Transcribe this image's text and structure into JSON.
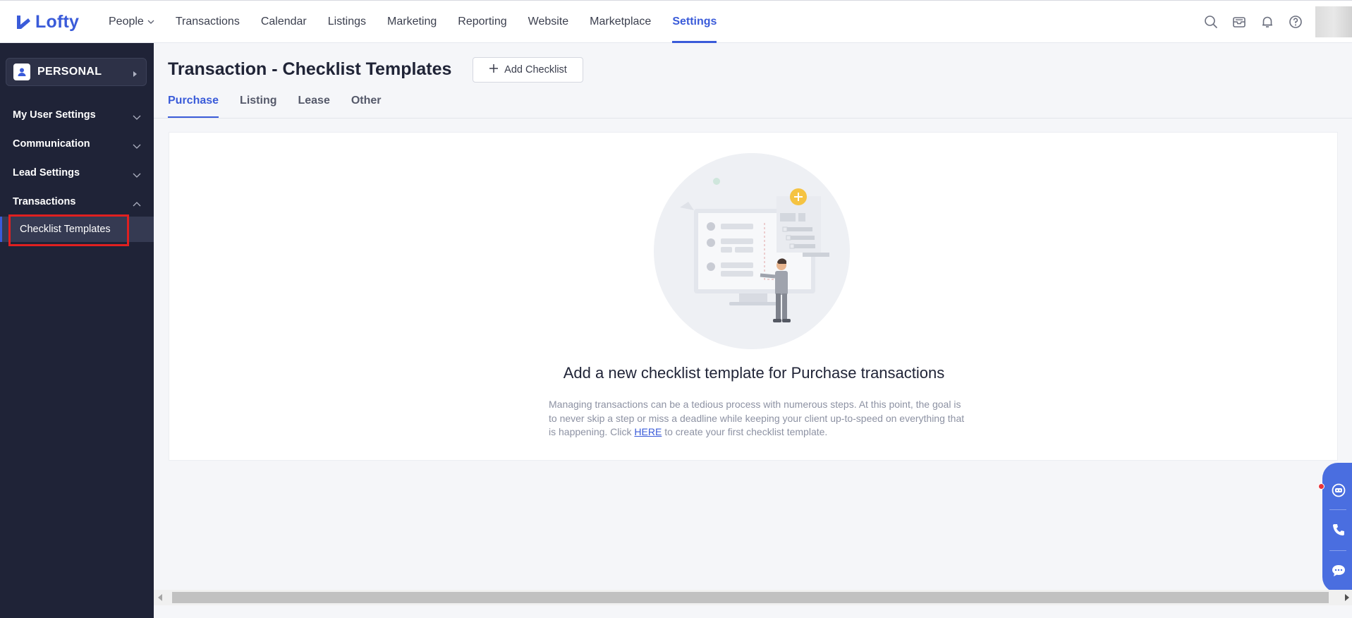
{
  "app": {
    "logo_text": "Lofty",
    "brand_color": "#3a5bd9"
  },
  "nav": {
    "items": [
      {
        "label": "People",
        "has_dropdown": true
      },
      {
        "label": "Transactions"
      },
      {
        "label": "Calendar"
      },
      {
        "label": "Listings"
      },
      {
        "label": "Marketing"
      },
      {
        "label": "Reporting"
      },
      {
        "label": "Website"
      },
      {
        "label": "Marketplace"
      },
      {
        "label": "Settings",
        "active": true
      }
    ],
    "icons": [
      "search-icon",
      "inbox-icon",
      "bell-icon",
      "help-icon"
    ]
  },
  "sidebar": {
    "switcher_label": "PERSONAL",
    "items": [
      {
        "label": "My User Settings",
        "expanded": false
      },
      {
        "label": "Communication",
        "expanded": false
      },
      {
        "label": "Lead Settings",
        "expanded": false
      },
      {
        "label": "Transactions",
        "expanded": true
      }
    ],
    "sub_items": [
      {
        "label": "Checklist Templates",
        "active": true
      }
    ]
  },
  "main": {
    "title": "Transaction - Checklist Templates",
    "add_button_label": "Add Checklist",
    "tabs": [
      {
        "label": "Purchase",
        "active": true
      },
      {
        "label": "Listing"
      },
      {
        "label": "Lease"
      },
      {
        "label": "Other"
      }
    ],
    "empty_state": {
      "title": "Add a new checklist template for Purchase transactions",
      "description_before": "Managing transactions can be a tedious process with numerous steps. At this point, the goal is to never skip a step or miss a deadline while keeping your client up-to-speed on everything that is happening. Click",
      "link_text": "HERE",
      "description_after": "to create your first checklist template."
    }
  },
  "floating_widget": {
    "icons": [
      "chat-bot-icon",
      "phone-icon",
      "message-icon"
    ]
  }
}
